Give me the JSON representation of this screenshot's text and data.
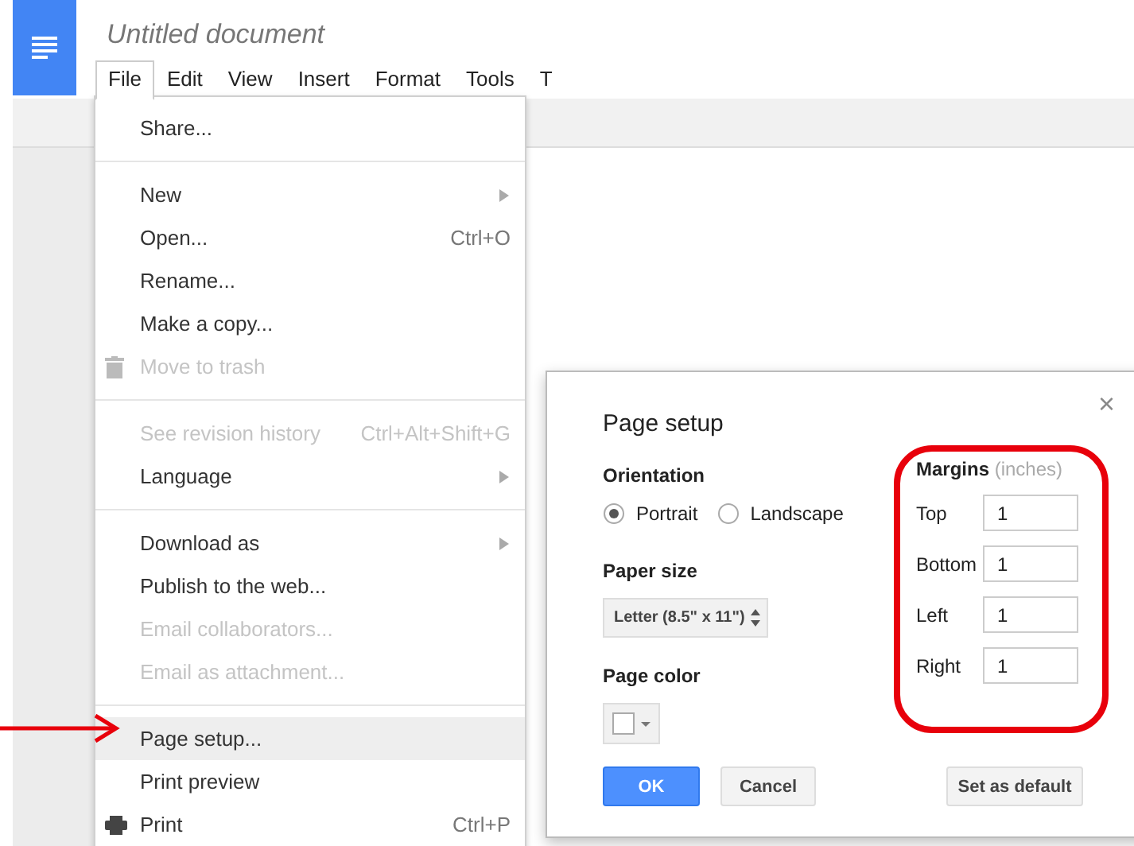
{
  "document": {
    "title": "Untitled document"
  },
  "menubar": [
    {
      "label": "File",
      "selected": true
    },
    {
      "label": "Edit",
      "selected": false
    },
    {
      "label": "View",
      "selected": false
    },
    {
      "label": "Insert",
      "selected": false
    },
    {
      "label": "Format",
      "selected": false
    },
    {
      "label": "Tools",
      "selected": false
    },
    {
      "label": "T",
      "selected": false
    }
  ],
  "file_menu": [
    [
      {
        "label": "Share...",
        "kind": "plain",
        "disabled": false,
        "highlighted": false
      }
    ],
    [
      {
        "label": "New",
        "kind": "submenu",
        "disabled": false,
        "highlighted": false
      },
      {
        "label": "Open...",
        "shortcut": "Ctrl+O",
        "kind": "plain",
        "disabled": false,
        "highlighted": false
      },
      {
        "label": "Rename...",
        "kind": "plain",
        "disabled": false,
        "highlighted": false
      },
      {
        "label": "Make a copy...",
        "kind": "plain",
        "disabled": false,
        "highlighted": false
      },
      {
        "label": "Move to trash",
        "kind": "trash",
        "disabled": true,
        "highlighted": false
      }
    ],
    [
      {
        "label": "See revision history",
        "shortcut": "Ctrl+Alt+Shift+G",
        "kind": "plain",
        "disabled": true,
        "highlighted": false
      },
      {
        "label": "Language",
        "kind": "submenu",
        "disabled": false,
        "highlighted": false
      }
    ],
    [
      {
        "label": "Download as",
        "kind": "submenu",
        "disabled": false,
        "highlighted": false
      },
      {
        "label": "Publish to the web...",
        "kind": "plain",
        "disabled": false,
        "highlighted": false
      },
      {
        "label": "Email collaborators...",
        "kind": "plain",
        "disabled": true,
        "highlighted": false
      },
      {
        "label": "Email as attachment...",
        "kind": "plain",
        "disabled": true,
        "highlighted": false
      }
    ],
    [
      {
        "label": "Page setup...",
        "kind": "plain",
        "disabled": false,
        "highlighted": true
      },
      {
        "label": "Print preview",
        "kind": "plain",
        "disabled": false,
        "highlighted": false
      },
      {
        "label": "Print",
        "shortcut": "Ctrl+P",
        "kind": "print",
        "disabled": false,
        "highlighted": false
      }
    ]
  ],
  "page_setup_dialog": {
    "title": "Page setup",
    "close": "×",
    "orientation": {
      "label": "Orientation",
      "options": [
        {
          "label": "Portrait",
          "selected": true
        },
        {
          "label": "Landscape",
          "selected": false
        }
      ]
    },
    "paper_size": {
      "label": "Paper size",
      "value": "Letter (8.5\" x 11\")"
    },
    "page_color": {
      "label": "Page color",
      "color": "#ffffff"
    },
    "margins": {
      "label": "Margins",
      "unit": "(inches)",
      "fields": [
        {
          "label": "Top",
          "value": "1"
        },
        {
          "label": "Bottom",
          "value": "1"
        },
        {
          "label": "Left",
          "value": "1"
        },
        {
          "label": "Right",
          "value": "1"
        }
      ]
    },
    "buttons": [
      {
        "label": "OK",
        "kind": "primary"
      },
      {
        "label": "Cancel",
        "kind": "secondary"
      },
      {
        "label": "Set as default",
        "kind": "secondary"
      }
    ]
  }
}
